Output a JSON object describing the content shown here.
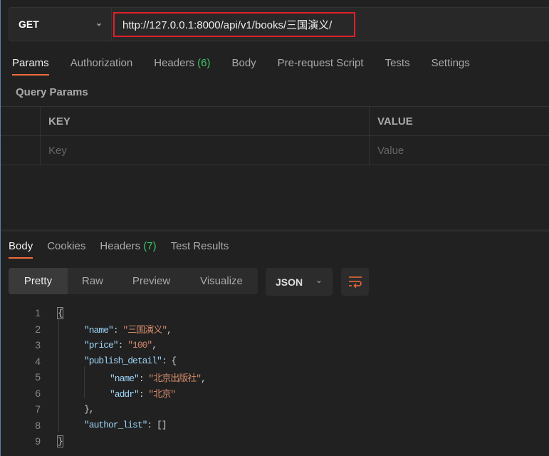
{
  "request": {
    "method": "GET",
    "url": "http://127.0.0.1:8000/api/v1/books/三国演义/"
  },
  "request_tabs": [
    {
      "label": "Params"
    },
    {
      "label": "Authorization"
    },
    {
      "label": "Headers",
      "count": "(6)"
    },
    {
      "label": "Body"
    },
    {
      "label": "Pre-request Script"
    },
    {
      "label": "Tests"
    },
    {
      "label": "Settings"
    }
  ],
  "query_params": {
    "title": "Query Params",
    "headers": [
      "KEY",
      "VALUE"
    ],
    "key_placeholder": "Key",
    "value_placeholder": "Value"
  },
  "response_tabs": [
    {
      "label": "Body"
    },
    {
      "label": "Cookies"
    },
    {
      "label": "Headers",
      "count": "(7)"
    },
    {
      "label": "Test Results"
    }
  ],
  "view_modes": [
    "Pretty",
    "Raw",
    "Preview",
    "Visualize"
  ],
  "format": "JSON",
  "code": {
    "l1": "{",
    "name_k": "\"name\"",
    "name_v": "\"三国演义\"",
    "price_k": "\"price\"",
    "price_v": "\"100\"",
    "pd_k": "\"publish_detail\"",
    "pn_k": "\"name\"",
    "pn_v": "\"北京出版社\"",
    "pa_k": "\"addr\"",
    "pa_v": "\"北京\"",
    "al_k": "\"author_list\"",
    "al_v": "[]",
    "close": "}"
  },
  "colors": {
    "accent": "#f26b3a",
    "highlight_box": "#e0202a",
    "count": "#3fc26b"
  }
}
